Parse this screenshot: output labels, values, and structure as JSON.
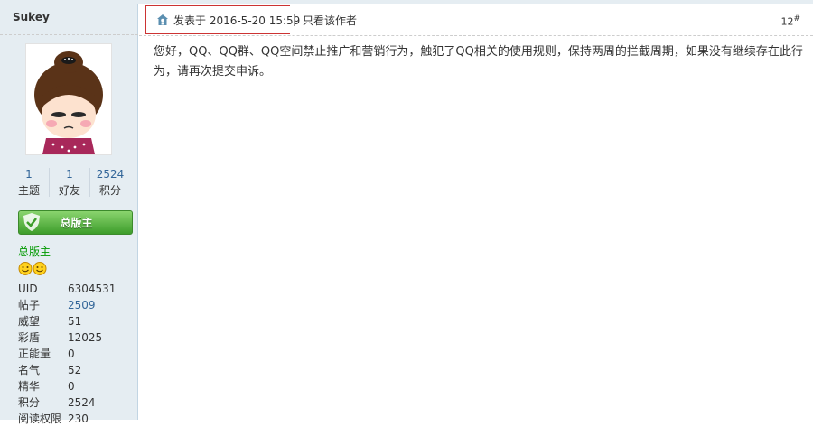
{
  "user": {
    "name": "Sukey",
    "stats": [
      {
        "num": "1",
        "label": "主题"
      },
      {
        "num": "1",
        "label": "好友"
      },
      {
        "num": "2524",
        "label": "积分"
      }
    ],
    "badge_label": "总版主",
    "group": "总版主",
    "info": [
      {
        "key": "UID",
        "value": "6304531"
      },
      {
        "key": "帖子",
        "value": "2509"
      },
      {
        "key": "威望",
        "value": "51"
      },
      {
        "key": "彩盾",
        "value": "12025"
      },
      {
        "key": "正能量",
        "value": "0"
      },
      {
        "key": "名气",
        "value": "52"
      },
      {
        "key": "精华",
        "value": "0"
      },
      {
        "key": "积分",
        "value": "2524"
      },
      {
        "key": "阅读权限",
        "value": "230"
      }
    ]
  },
  "post": {
    "posted_on": "发表于 2016-5-20 15:59",
    "author_only": "只看该作者",
    "floor": "12",
    "floor_suffix": "#",
    "body": "您好，QQ、QQ群、QQ空间禁止推广和营销行为，触犯了QQ相关的使用规则，保持两周的拦截周期，如果没有继续存在此行为，请再次提交申诉。"
  },
  "colors": {
    "sidebar_bg": "#e5edf2",
    "link": "#336699",
    "group": "#009900",
    "badge_green": "#3d9d2b",
    "highlight_border": "#cc3333"
  }
}
